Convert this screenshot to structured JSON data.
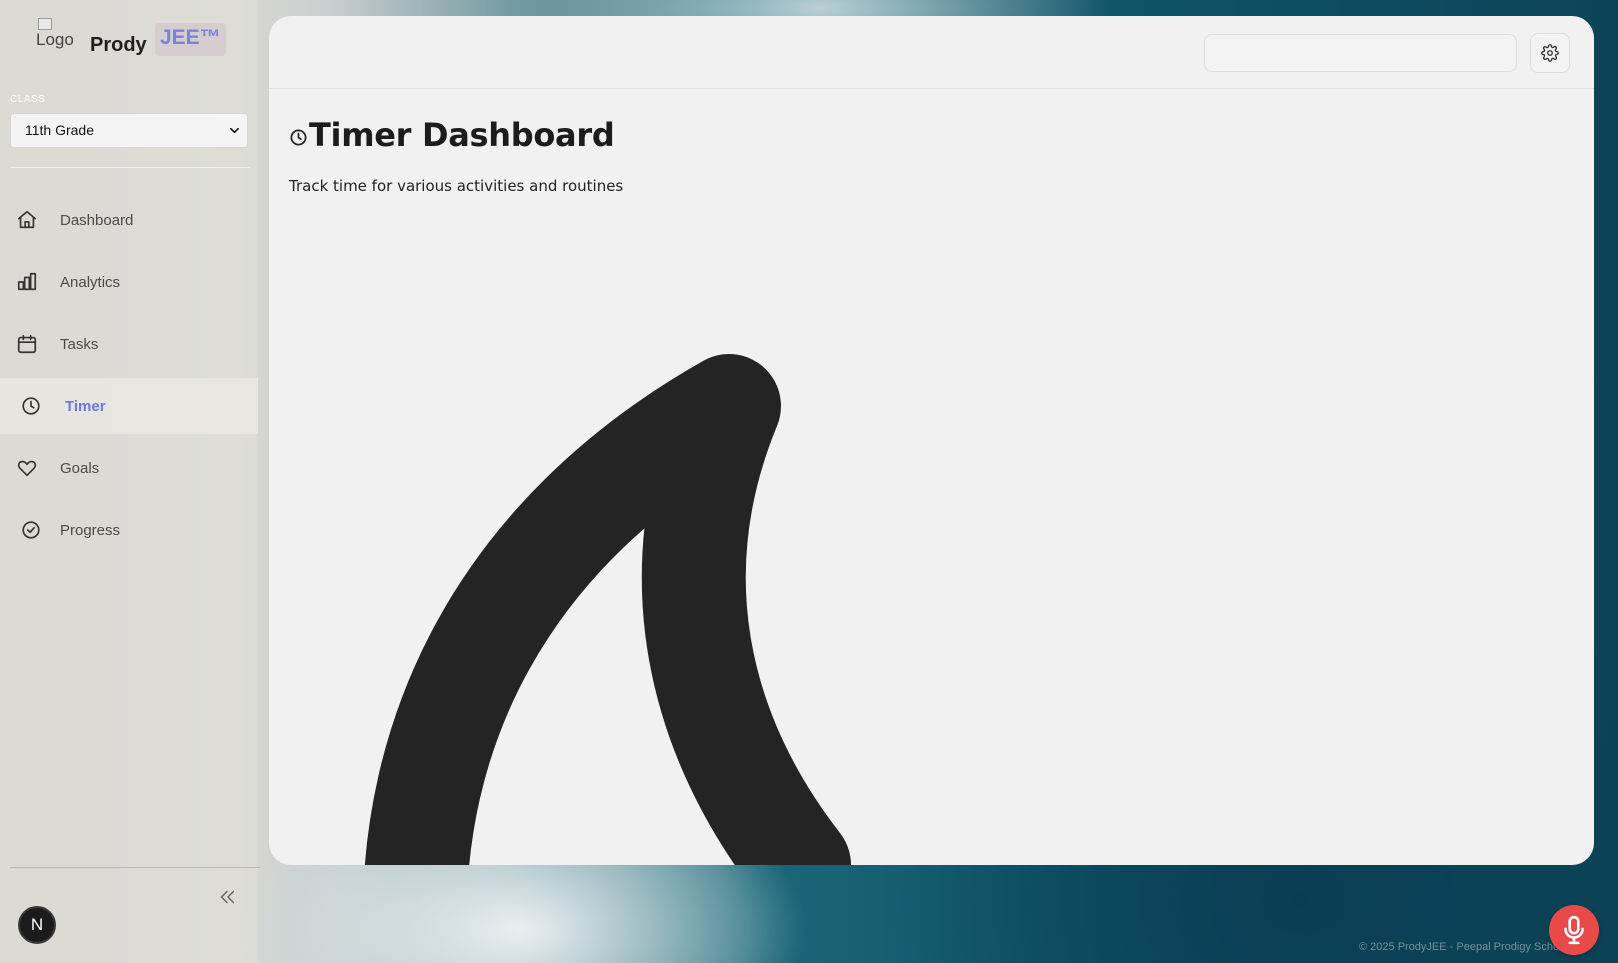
{
  "brand": {
    "logo_alt": "Logo",
    "name": "Prody",
    "badge": "JEE™"
  },
  "class_selector": {
    "label": "CLASS",
    "selected": "11th Grade"
  },
  "sidebar": {
    "items": [
      {
        "label": "Dashboard",
        "icon": "home-icon"
      },
      {
        "label": "Analytics",
        "icon": "bar-chart-icon"
      },
      {
        "label": "Tasks",
        "icon": "calendar-icon"
      },
      {
        "label": "Timer",
        "icon": "clock-icon",
        "active": true
      },
      {
        "label": "Goals",
        "icon": "heart-icon"
      },
      {
        "label": "Progress",
        "icon": "check-circle-icon"
      }
    ]
  },
  "user": {
    "avatar_initial": "N"
  },
  "header": {
    "search_placeholder": ""
  },
  "page": {
    "title": "Timer Dashboard",
    "subtitle": "Track time for various activities and routines"
  },
  "footer": {
    "text": "© 2025 ProdyJEE - Peepal Prodigy School"
  },
  "colors": {
    "accent": "#6d76e2",
    "badge_text": "#7c82d8",
    "mic_button": "#e84a4a",
    "panel_bg": "#f1f1f1"
  }
}
